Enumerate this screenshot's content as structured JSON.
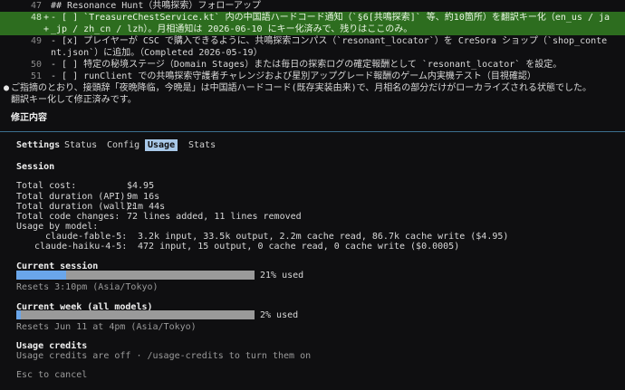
{
  "diff": {
    "lines": [
      {
        "num": "47",
        "text": "## Resonance Hunt（共鳴探索）フォローアップ"
      },
      {
        "num": "48",
        "text": "- [ ] `TreasureChestService.kt` 内の中国語ハードコード通知（`§6[共鳴探索]` 等、約10箇所）を翻訳キー化（en_us / ja"
      },
      {
        "num": "",
        "text": "_jp / zh_cn / lzh）。月相通知は 2026-06-10 にキー化済みで、残りはここのみ。"
      },
      {
        "num": "49",
        "text": "- [x] プレイヤーが CSC で購入できるように、共鳴探索コンパス（`resonant_locator`）を CreSora ショップ（`shop_conte"
      },
      {
        "num": "",
        "text": "nt.json`）に追加。（Completed 2026-05-19）"
      },
      {
        "num": "50",
        "text": "- [ ] 特定の秘境ステージ（Domain Stages）または毎日の探索ログの確定報酬として `resonant_locator` を設定。"
      },
      {
        "num": "51",
        "text": "- [ ] runClient での共鳴探索守護者チャレンジおよび星別アップグレード報酬のゲーム内実機テスト（目視確認）"
      }
    ],
    "added_marker": "+"
  },
  "message": {
    "bullet": "●",
    "line1": "ご指摘のとおり、接頭辞「夜晩降临，今晩是」は中国語ハードコード(既存実装由来)で、月相名の部分だけがローカライズされる状態でした。",
    "line2": "翻訳キー化して修正済みです。"
  },
  "section_title": "修正内容",
  "tabs": [
    {
      "label": "Settings"
    },
    {
      "label": "Status"
    },
    {
      "label": "Config"
    },
    {
      "label": "Usage"
    },
    {
      "label": "Stats"
    }
  ],
  "session": {
    "heading": "Session",
    "total_cost_label": "Total cost:",
    "total_cost_value": "$4.95",
    "api_label": "Total duration (API):",
    "api_value": "9m 16s",
    "wall_label": "Total duration (wall):",
    "wall_value": "21m 44s",
    "changes_label": "Total code changes:",
    "changes_value": "72 lines added, 11 lines removed",
    "by_model_label": "Usage by model:",
    "models": [
      {
        "name": "claude-fable-5:",
        "usage": "3.2k input, 33.5k output, 2.2m cache read, 86.7k cache write ($4.95)"
      },
      {
        "name": "claude-haiku-4-5:",
        "usage": "472 input, 15 output, 0 cache read, 0 cache write ($0.0005)"
      }
    ]
  },
  "current_session": {
    "heading": "Current session",
    "percent": 0.21,
    "percent_label": "21% used",
    "resets": "Resets 3:10pm (Asia/Tokyo)"
  },
  "current_week": {
    "heading": "Current week (all models)",
    "percent": 0.02,
    "percent_label": "2% used",
    "resets": "Resets Jun 11 at 4pm (Asia/Tokyo)"
  },
  "credits": {
    "heading": "Usage credits",
    "text": "Usage credits are off · /usage-credits to turn them on"
  },
  "footer": "Esc to cancel",
  "colors": {
    "background": "#0f0f11",
    "added_bg": "#2d6d1f",
    "bar_fill": "#6aa6ea",
    "bar_track": "#9a9a9a",
    "active_tab": "#a8c8e8",
    "rule": "#3c6f8f"
  }
}
